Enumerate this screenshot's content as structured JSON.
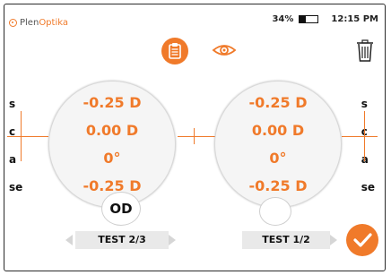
{
  "brand": {
    "part1": "Plen",
    "part2": "Optika"
  },
  "status": {
    "battery": "34%",
    "time": "12:15 PM",
    "battery_level": 0.34
  },
  "colors": {
    "accent": "#f07a2a",
    "lens_bg": "#f5f5f5",
    "pill_bg": "#e9e9e9"
  },
  "axis_labels": [
    "s",
    "c",
    "a",
    "se"
  ],
  "left_eye": {
    "values": [
      "-0.25 D",
      "0.00 D",
      "0°",
      "-0.25 D"
    ],
    "eye_label": "OD",
    "test": "TEST 2/3"
  },
  "right_eye": {
    "values": [
      "-0.25 D",
      "0.00 D",
      "0°",
      "-0.25 D"
    ],
    "test": "TEST 1/2"
  },
  "icons": {
    "clipboard": "clipboard-icon",
    "eye": "eye-icon",
    "trash": "trash-icon",
    "check": "check-icon"
  }
}
